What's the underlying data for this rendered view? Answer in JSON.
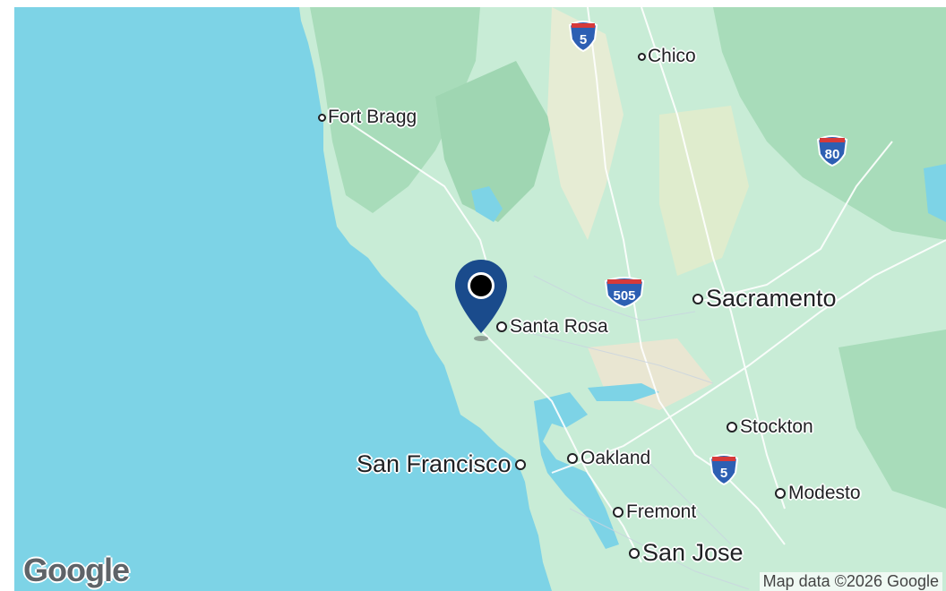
{
  "map": {
    "attribution": "Map data ©2026 Google",
    "logo": "Google",
    "colors": {
      "water": "#7dd3e6",
      "land": "#c8ecd6",
      "forest": "#a8dcba",
      "pin": "#1a4b8c"
    },
    "cities": [
      {
        "name": "Chico",
        "size": "small"
      },
      {
        "name": "Fort Bragg",
        "size": "small"
      },
      {
        "name": "Santa Rosa",
        "size": "small"
      },
      {
        "name": "Sacramento",
        "size": "big"
      },
      {
        "name": "Stockton",
        "size": "small"
      },
      {
        "name": "Oakland",
        "size": "small"
      },
      {
        "name": "San Francisco",
        "size": "big"
      },
      {
        "name": "Modesto",
        "size": "small"
      },
      {
        "name": "Fremont",
        "size": "small"
      },
      {
        "name": "San Jose",
        "size": "big"
      }
    ],
    "highways": [
      {
        "label": "5",
        "type": "interstate"
      },
      {
        "label": "80",
        "type": "interstate"
      },
      {
        "label": "505",
        "type": "interstate"
      },
      {
        "label": "5",
        "type": "interstate"
      }
    ],
    "marker": {
      "icon": "map-pin-icon"
    }
  }
}
